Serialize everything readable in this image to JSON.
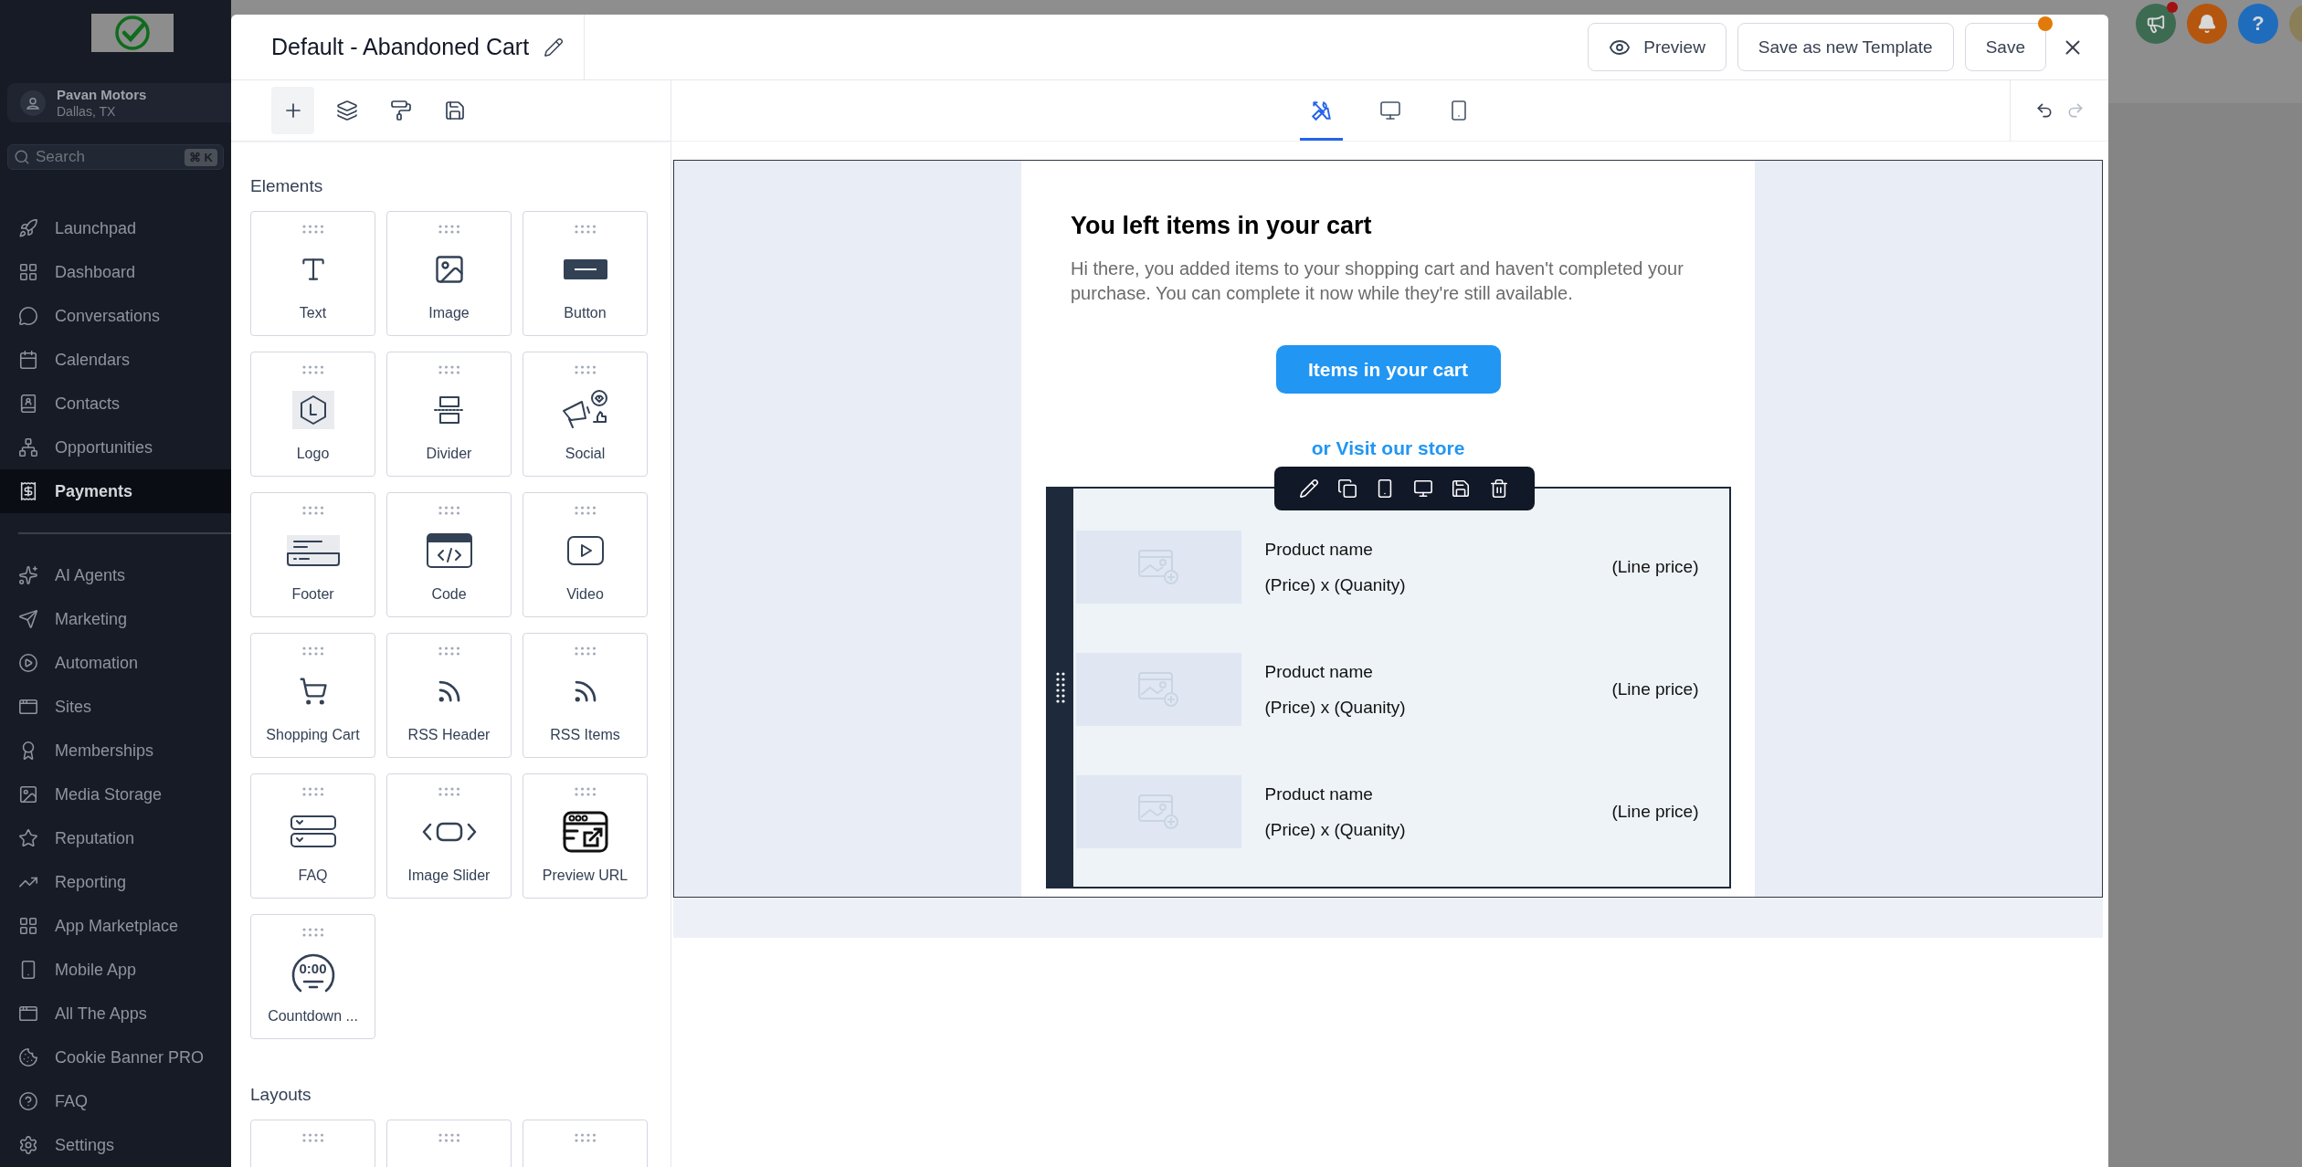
{
  "sidebar": {
    "account": {
      "name": "Pavan Motors",
      "location": "Dallas, TX"
    },
    "search": {
      "placeholder": "Search",
      "shortcut": "⌘ K"
    },
    "groups": [
      [
        {
          "label": "Launchpad",
          "selected": false
        },
        {
          "label": "Dashboard",
          "selected": false
        },
        {
          "label": "Conversations",
          "selected": false
        },
        {
          "label": "Calendars",
          "selected": false
        },
        {
          "label": "Contacts",
          "selected": false
        },
        {
          "label": "Opportunities",
          "selected": false
        },
        {
          "label": "Payments",
          "selected": true
        }
      ],
      [
        {
          "label": "AI Agents",
          "selected": false
        },
        {
          "label": "Marketing",
          "selected": false
        },
        {
          "label": "Automation",
          "selected": false
        },
        {
          "label": "Sites",
          "selected": false
        },
        {
          "label": "Memberships",
          "selected": false
        },
        {
          "label": "Media Storage",
          "selected": false
        },
        {
          "label": "Reputation",
          "selected": false
        },
        {
          "label": "Reporting",
          "selected": false
        },
        {
          "label": "App Marketplace",
          "selected": false
        },
        {
          "label": "Mobile App",
          "selected": false
        },
        {
          "label": "All The Apps",
          "selected": false
        },
        {
          "label": "Cookie Banner PRO",
          "selected": false
        },
        {
          "label": "FAQ",
          "selected": false
        },
        {
          "label": "Settings",
          "selected": false
        }
      ]
    ]
  },
  "topbar": {
    "help": "?",
    "notifications": [
      {
        "kind": "megaphone",
        "unread": true
      },
      {
        "kind": "bell",
        "unread": false
      }
    ]
  },
  "editor": {
    "title": "Default - Abandoned Cart",
    "header_buttons": [
      {
        "kind": "preview",
        "label": "Preview"
      },
      {
        "kind": "plain",
        "label": "Save as new Template"
      },
      {
        "kind": "save",
        "label": "Save",
        "unsaved": true
      }
    ],
    "panel_tools": [
      {
        "selected": true
      },
      {
        "selected": false
      },
      {
        "selected": false
      },
      {
        "selected": false
      }
    ],
    "device_tabs": [
      {
        "selected": true
      },
      {
        "selected": false
      },
      {
        "selected": false
      }
    ],
    "history": {
      "undo_disabled": false,
      "redo_disabled": true
    },
    "elements": {
      "heading": "Elements",
      "items": [
        {
          "label": "Text"
        },
        {
          "label": "Image"
        },
        {
          "label": "Button"
        },
        {
          "label": "Logo"
        },
        {
          "label": "Divider"
        },
        {
          "label": "Social"
        },
        {
          "label": "Footer"
        },
        {
          "label": "Code"
        },
        {
          "label": "Video"
        },
        {
          "label": "Shopping Cart"
        },
        {
          "label": "RSS Header"
        },
        {
          "label": "RSS Items"
        },
        {
          "label": "FAQ"
        },
        {
          "label": "Image Slider"
        },
        {
          "label": "Preview URL"
        },
        {
          "label": "Countdown ...",
          "icon_text": "0:00"
        }
      ]
    },
    "layouts": {
      "heading": "Layouts",
      "items": [
        {
          "kind": "layout"
        },
        {
          "kind": "layout"
        },
        {
          "kind": "layout"
        }
      ]
    }
  },
  "email": {
    "heading": "You left items in your cart",
    "body": "Hi there, you added items to your shopping cart and haven't completed your purchase. You can complete it now while they're still available.",
    "button": "Items in your cart",
    "link": "or Visit our store",
    "cart_rows": [
      {
        "name": "Product name",
        "price_line": "(Price) x (Quanity)",
        "line_price": "(Line price)"
      },
      {
        "name": "Product name",
        "price_line": "(Price) x (Quanity)",
        "line_price": "(Line price)"
      },
      {
        "name": "Product name",
        "price_line": "(Price) x (Quanity)",
        "line_price": "(Line price)"
      }
    ]
  }
}
